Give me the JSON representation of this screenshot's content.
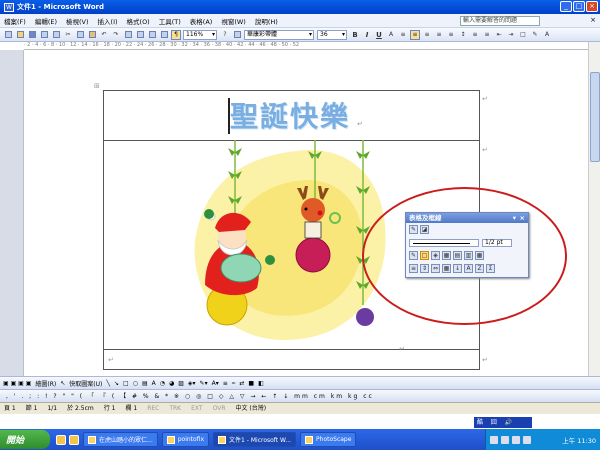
{
  "window": {
    "title": "文件1 - Microsoft Word",
    "doc_icon_label": "W"
  },
  "menu": {
    "items": [
      "檔案(F)",
      "編輯(E)",
      "檢視(V)",
      "插入(I)",
      "格式(O)",
      "工具(T)",
      "表格(A)",
      "視窗(W)",
      "說明(H)"
    ],
    "help_placeholder": "輸入需要解答的問題",
    "close_glyph": "×"
  },
  "toolbar": {
    "zoom": "116%",
    "font": "華康彩帶體",
    "size": "36",
    "bold": "B",
    "italic": "I",
    "underline": "U"
  },
  "document": {
    "title_text": "聖誕快樂",
    "paragraph_mark": "↵"
  },
  "tables_panel": {
    "title": "表格及框線",
    "line_weight": "1/2 pt"
  },
  "drawing_bar": {
    "draw_label": "繪圖(R)",
    "autoshapes_label": "快取圖案(U)"
  },
  "symbol_bar": {
    "symbols": ", ' . ; : ! ? \" \" ( 「 『 ( 【 # % & * ※ ○ ◎ □ ◇ △ ▽ → ← ↑ ↓ mm cm km kg cc"
  },
  "status": {
    "page": "頁 1",
    "section": "節 1",
    "pages": "1/1",
    "position": "於 2.5cm",
    "line": "行 1",
    "column": "欄 1",
    "rec": "REC",
    "trk": "TRK",
    "ext": "EXT",
    "ovr": "OVR",
    "lang": "中文 (台灣)"
  },
  "taskbar": {
    "start": "開始",
    "tasks": [
      "在虎山踏小的眾仁...",
      "pointofix",
      "文件1 - Microsoft W...",
      "PhotoScape"
    ],
    "ime": "酷 囧 🔊",
    "clock": "上午 11:30"
  }
}
